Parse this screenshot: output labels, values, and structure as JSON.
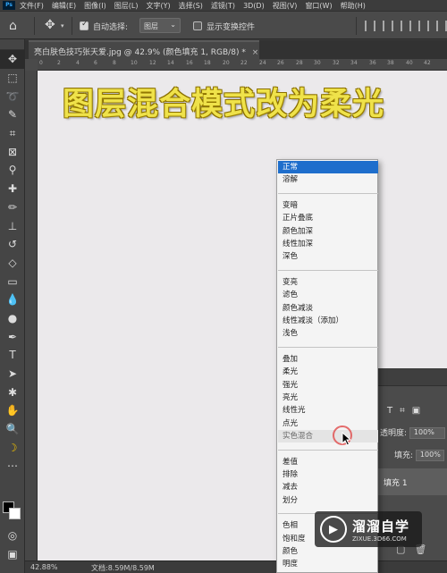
{
  "app": {
    "logo": "Ps"
  },
  "menu": [
    "文件(F)",
    "编辑(E)",
    "图像(I)",
    "图层(L)",
    "文字(Y)",
    "选择(S)",
    "滤镜(T)",
    "3D(D)",
    "视图(V)",
    "窗口(W)",
    "帮助(H)"
  ],
  "options": {
    "home_icon": "home-icon",
    "move_icon": "move-tool-icon",
    "auto_select_label": "自动选择:",
    "auto_select_checked": true,
    "auto_select_value": "图层",
    "show_transform_label": "显示变换控件",
    "show_transform_checked": false
  },
  "document_tab": {
    "title": "亮白肤色技巧张天爱.jpg @ 42.9% (颜色填充 1, RGB/8) *",
    "close": "×"
  },
  "ruler_marks": [
    "0",
    "2",
    "4",
    "6",
    "8",
    "10",
    "12",
    "14",
    "16",
    "18",
    "20",
    "22",
    "24",
    "26",
    "28",
    "30",
    "32",
    "34",
    "36",
    "38",
    "40",
    "42"
  ],
  "canvas": {
    "caption": "图层混合模式改为柔光",
    "caption_color": "#efe24a",
    "background": "#ebe9eb"
  },
  "blend_modes": {
    "groups": [
      [
        "正常",
        "溶解"
      ],
      [
        "变暗",
        "正片叠底",
        "颜色加深",
        "线性加深",
        "深色"
      ],
      [
        "变亮",
        "滤色",
        "颜色减淡",
        "线性减淡（添加）",
        "浅色"
      ],
      [
        "叠加",
        "柔光",
        "强光",
        "亮光",
        "线性光",
        "点光",
        "实色混合"
      ],
      [
        "差值",
        "排除",
        "减去",
        "划分"
      ],
      [
        "色相",
        "饱和度",
        "颜色",
        "明度"
      ]
    ],
    "selected": "正常",
    "hovered": "实色混合",
    "selected_color": "#1e6ecc"
  },
  "layers_panel": {
    "opacity_label": "透明度:",
    "opacity_value": "100%",
    "fill_label": "填充:",
    "fill_value": "100%",
    "layer_name": "填充 1"
  },
  "status": {
    "zoom": "42.88%",
    "doc": "文档:8.59M/8.59M"
  },
  "watermark": {
    "title": "溜溜自学",
    "url": "ZIXUE.3D66.COM"
  }
}
